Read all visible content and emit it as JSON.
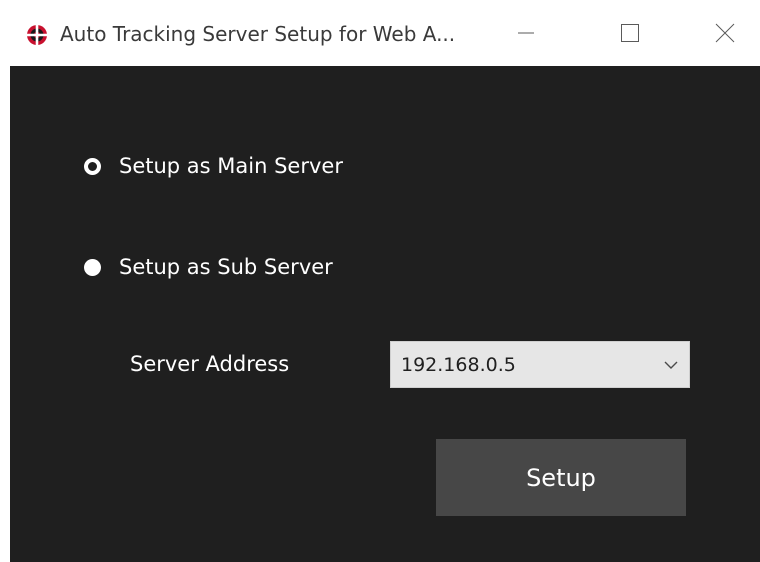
{
  "window": {
    "title": "Auto Tracking Server Setup for Web A...",
    "icon": "app-lifebuoy-icon",
    "controls": [
      "minimize-icon",
      "maximize-icon",
      "close-icon"
    ]
  },
  "options": {
    "main_server_label": "Setup as Main Server",
    "main_server_selected": true,
    "sub_server_label": "Setup as Sub Server",
    "sub_server_selected": false
  },
  "server_address": {
    "label": "Server Address",
    "value": "192.168.0.5",
    "dropdown_icon": "chevron-down-icon"
  },
  "actions": {
    "setup_label": "Setup"
  },
  "colors": {
    "background": "#1f1f1f",
    "button": "#474747",
    "combo": "#e6e6e6",
    "icon_red": "#c8102e"
  }
}
